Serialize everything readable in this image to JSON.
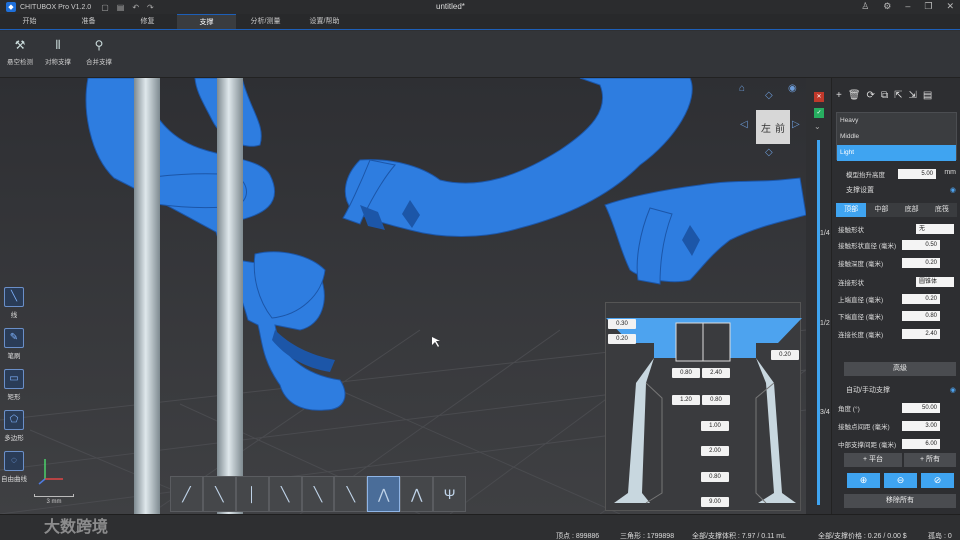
{
  "window": {
    "app_name": "CHITUBOX Pro V1.2.0",
    "doc_title": "untitled*"
  },
  "menu": [
    "开始",
    "准备",
    "修复",
    "支撑",
    "分析/测量",
    "设置/帮助"
  ],
  "ribbon": {
    "hollow_detect": "悬空检测",
    "mirror_support": "对称支撑",
    "merge_support": "合并支撑"
  },
  "left_tools": [
    {
      "label": "线",
      "icon": "line-icon"
    },
    {
      "label": "笔刷",
      "icon": "brush-icon"
    },
    {
      "label": "矩形",
      "icon": "rectangle-icon"
    },
    {
      "label": "多边形",
      "icon": "polygon-icon"
    },
    {
      "label": "自由曲线",
      "icon": "freehand-icon"
    }
  ],
  "nav_cube": {
    "left": "左",
    "front": "前"
  },
  "scale_label": "3 mm",
  "diagram_values": {
    "top_a": "0.30",
    "top_b": "0.20",
    "right_a": "0.20",
    "mid_left": "0.80",
    "mid_right": "2.40",
    "low_left": "1.20",
    "low_right": "0.80",
    "v1": "1.00",
    "v2": "2.00",
    "v3": "0.80",
    "v4": "9.00"
  },
  "slider_marks": [
    "1/4",
    "1/2",
    "3/4"
  ],
  "panel": {
    "profiles": [
      "Heavy",
      "Middle",
      "Light"
    ],
    "selected_profile": "Light",
    "lift_label": "模型抬升高度",
    "lift_value": "5.00",
    "lift_unit": "mm",
    "support_settings": "支撑设置",
    "tabs": [
      "顶部",
      "中部",
      "底部",
      "底筏"
    ],
    "contact_shape_label": "接触形状",
    "contact_shape_value": "无",
    "contact_diameter_label": "接触形状直径 (毫米)",
    "contact_diameter_value": "0.50",
    "contact_depth_label": "接触深度 (毫米)",
    "contact_depth_value": "0.20",
    "connection_shape_label": "连接形状",
    "connection_shape_value": "圆锥体",
    "upper_diameter_label": "上端直径 (毫米)",
    "upper_diameter_value": "0.20",
    "lower_diameter_label": "下端直径 (毫米)",
    "lower_diameter_value": "0.80",
    "connection_length_label": "连接长度 (毫米)",
    "connection_length_value": "2.40",
    "advanced_button": "高级",
    "auto_manual_label": "自动/手动支撑",
    "angle_label": "角度 (°)",
    "angle_value": "50.00",
    "contact_spacing_label": "接触点间距 (毫米)",
    "contact_spacing_value": "3.00",
    "mid_spacing_label": "中部支撑间距 (毫米)",
    "mid_spacing_value": "6.00",
    "add_platform": "+ 平台",
    "add_all": "+ 所有",
    "remove_all": "移除所有"
  },
  "status": {
    "vertices": "顶点 : 899886",
    "triangles": "三角形 : 1799898",
    "volume": "全部/支撑体积 : 7.97 / 0.11 mL",
    "price": "全部/支撑价格 : 0.26 / 0.00 $",
    "islands": "孤岛 : 0"
  },
  "watermark": "大数跨境",
  "colors": {
    "model": "#2e7de0",
    "accent": "#3fa4f1",
    "support": "#c8d7df"
  }
}
